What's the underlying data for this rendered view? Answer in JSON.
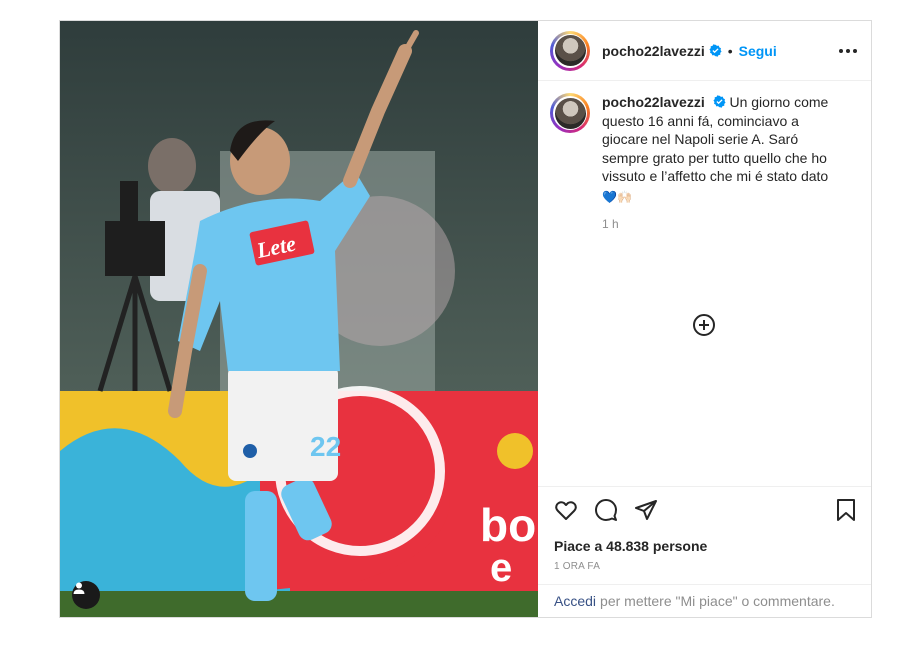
{
  "post": {
    "username": "pocho22lavezzi",
    "follow_label": "Segui",
    "dot": "•",
    "caption": "Un giorno come questo 16 anni fá, cominciavo a giocare nel Napoli serie A. Saró sempre grato per tutto quello che ho vissuto e l’affetto che mi é stato dato",
    "caption_emoji": "💙🙌🏻",
    "caption_time": "1 h",
    "likes": "Piace a 48.838 persone",
    "posted_time": "1 ORA FA"
  },
  "photo": {
    "sponsor": "Lete",
    "shirt_number": "22"
  },
  "footer": {
    "login_link": "Accedi",
    "login_text": "per mettere \"Mi piace\" o commentare."
  },
  "icons": {
    "more": "more-options-icon",
    "verified": "verified-badge-icon",
    "like": "heart-icon",
    "comment": "comment-icon",
    "share": "paper-plane-icon",
    "save": "bookmark-icon",
    "load_more": "plus-circle-icon",
    "tag": "user-tag-icon"
  },
  "colors": {
    "accent": "#0095f6",
    "verified": "#0095f6",
    "jersey": "#6ec6f0"
  }
}
